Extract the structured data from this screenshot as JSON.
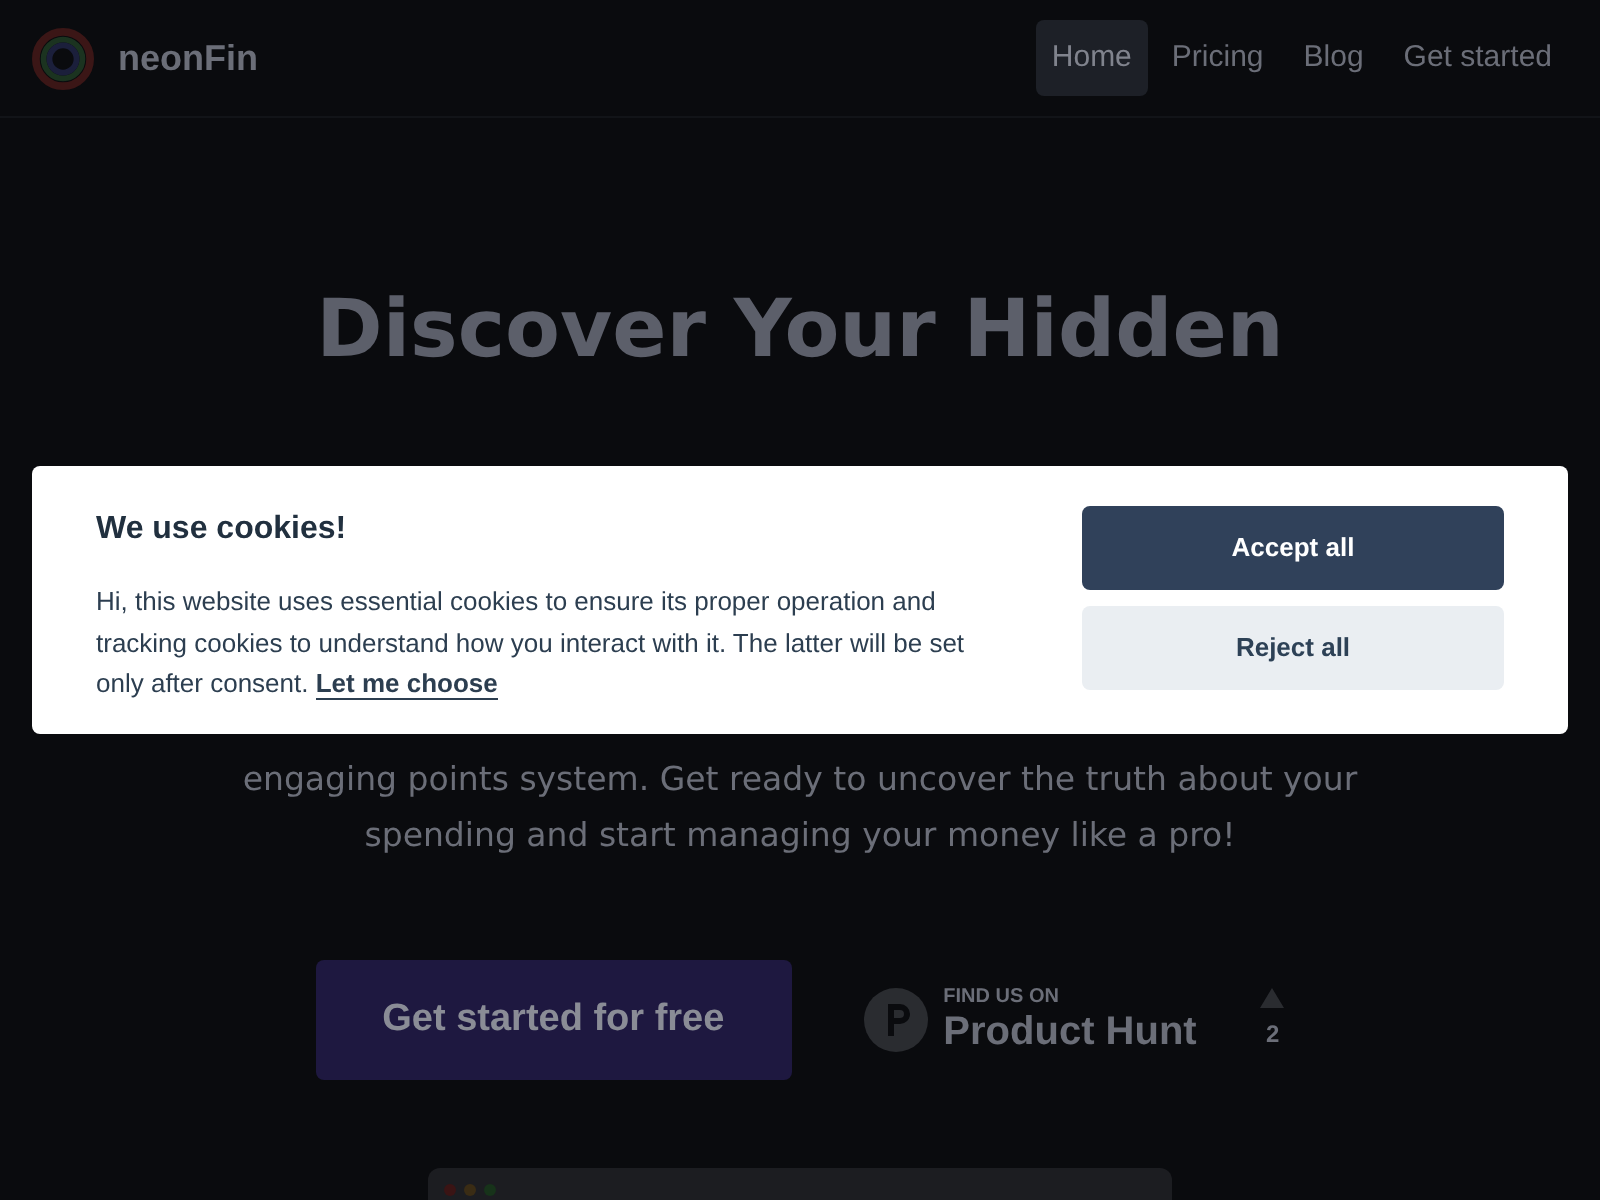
{
  "header": {
    "brand": "neonFin",
    "nav": [
      {
        "label": "Home",
        "selected": true
      },
      {
        "label": "Pricing",
        "selected": false
      },
      {
        "label": "Blog",
        "selected": false
      },
      {
        "label": "Get started",
        "selected": false
      }
    ]
  },
  "hero": {
    "title_lines": [
      "Discover Your Hidden"
    ],
    "description": "engaging points system. Get ready to uncover the truth about your spending and start managing your money like a pro!",
    "cta": "Get started for free",
    "product_hunt": {
      "caption": "FIND US ON",
      "name": "Product Hunt",
      "votes": "2"
    }
  },
  "cookie_banner": {
    "title": "We use cookies!",
    "text": "Hi, this website uses essential cookies to ensure its proper operation and tracking cookies to understand how you interact with it. The latter will be set only after consent.",
    "link": "Let me choose",
    "buttons": [
      {
        "label": "Accept all",
        "kind": "primary"
      },
      {
        "label": "Reject all",
        "kind": "secondary"
      }
    ]
  }
}
